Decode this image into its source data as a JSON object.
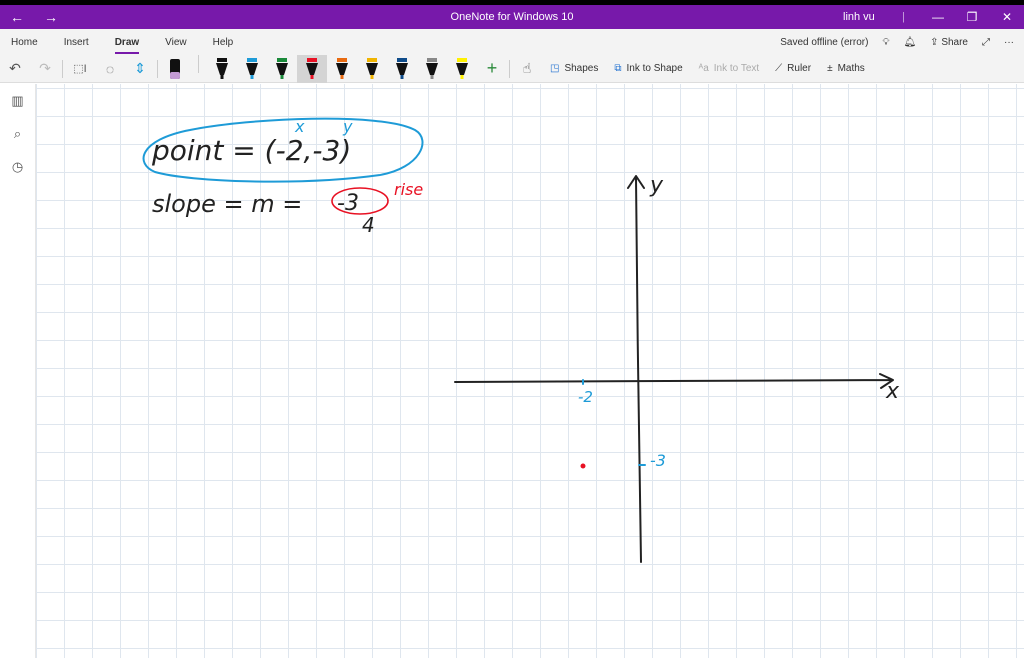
{
  "titlebar": {
    "title": "OneNote for Windows 10",
    "user": "linh vu",
    "back": "←",
    "forward": "→",
    "minimize": "—",
    "restore": "❐",
    "close": "✕",
    "separator": "|"
  },
  "tabs": [
    "Home",
    "Insert",
    "Draw",
    "View",
    "Help"
  ],
  "status": {
    "saved": "Saved offline (error)",
    "share": "Share",
    "more": "···"
  },
  "toolbar": {
    "shapes": "Shapes",
    "ink_to_shape": "Ink to Shape",
    "ink_to_text": "Ink to Text",
    "ruler": "Ruler",
    "maths": "Maths"
  },
  "pens": [
    {
      "color": "#c39bd3"
    },
    {
      "color": "#111111"
    },
    {
      "color": "#1e9bd7"
    },
    {
      "color": "#1a8a3a"
    },
    {
      "color": "#e81123"
    },
    {
      "color": "#e86a10"
    },
    {
      "color": "#f0b400"
    },
    {
      "color": "#0f4c8a"
    },
    {
      "color": "#888888"
    },
    {
      "color": "#fff100"
    }
  ],
  "ink": {
    "line1": "point = (-2,-3)",
    "x_label": "x",
    "y_label": "y",
    "line2": "slope = m =",
    "numerator": "-3",
    "denominator": "4",
    "rise": "rise",
    "axis_x": "x",
    "axis_y": "y",
    "tick_x": "-2",
    "tick_y": "-3"
  },
  "colors": {
    "accent": "#7719aa",
    "ink_black": "#222222",
    "ink_blue": "#1e9bd7",
    "ink_red": "#e81123"
  }
}
